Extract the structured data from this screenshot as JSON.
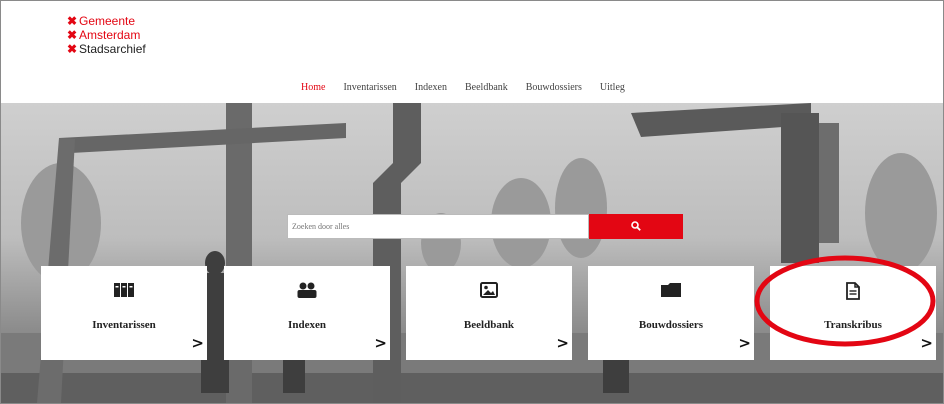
{
  "logo": {
    "line1": "Gemeente",
    "line2": "Amsterdam",
    "line3": "Stadsarchief"
  },
  "nav": {
    "items": [
      "Home",
      "Inventarissen",
      "Indexen",
      "Beeldbank",
      "Bouwdossiers",
      "Uitleg"
    ],
    "active": "Home"
  },
  "search": {
    "placeholder": "Zoeken door alles",
    "button_icon": "search-icon"
  },
  "tiles": [
    {
      "label": "Inventarissen",
      "icon": "archive-boxes-icon"
    },
    {
      "label": "Indexen",
      "icon": "people-icon"
    },
    {
      "label": "Beeldbank",
      "icon": "image-icon"
    },
    {
      "label": "Bouwdossiers",
      "icon": "folder-icon"
    },
    {
      "label": "Transkribus",
      "icon": "document-icon"
    }
  ],
  "annotation": {
    "color": "#e30613",
    "target": "Transkribus"
  },
  "colors": {
    "accent": "#e30613"
  }
}
